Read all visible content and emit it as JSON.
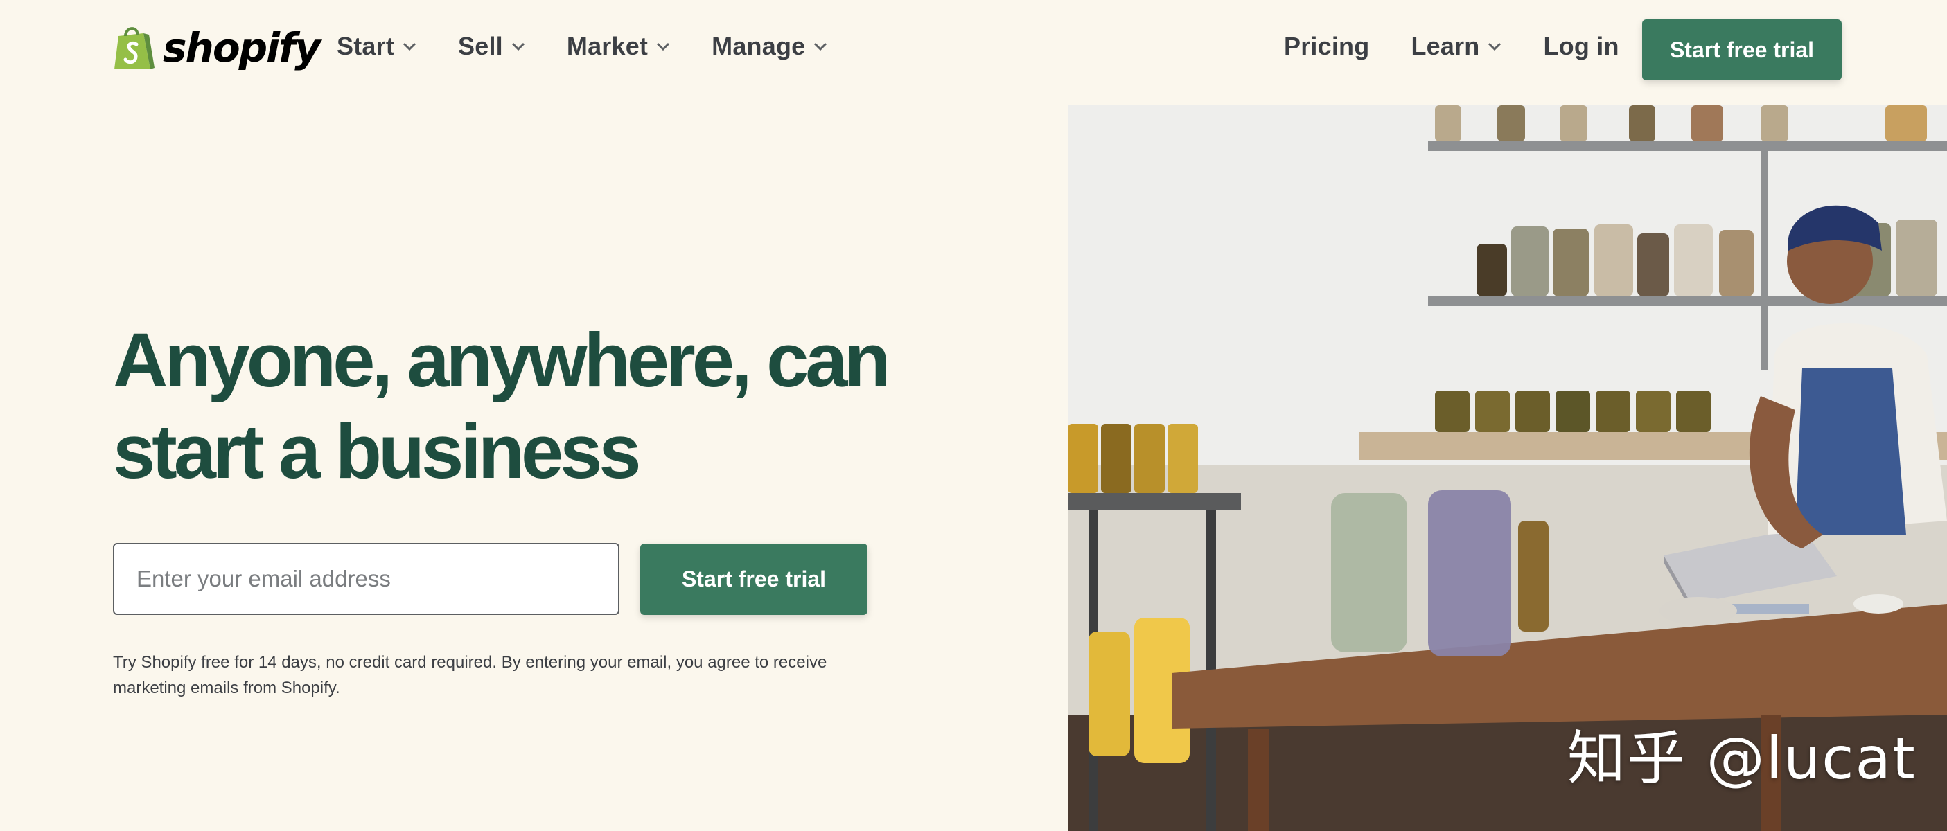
{
  "brand": {
    "name": "shopify",
    "logo_icon": "shopping-bag-icon",
    "logo_color": "#95bf47"
  },
  "nav": {
    "left": [
      {
        "label": "Start",
        "icon": "chevron-down-icon"
      },
      {
        "label": "Sell",
        "icon": "chevron-down-icon"
      },
      {
        "label": "Market",
        "icon": "chevron-down-icon"
      },
      {
        "label": "Manage",
        "icon": "chevron-down-icon"
      }
    ],
    "right": {
      "pricing": "Pricing",
      "learn": "Learn",
      "login": "Log in"
    },
    "cta": "Start free trial"
  },
  "hero": {
    "title_line1": "Anyone, anywhere, can",
    "title_line2": "start a business",
    "email_placeholder": "Enter your email address",
    "cta": "Start free trial",
    "disclaimer": "Try Shopify free for 14 days, no credit card required. By entering your email, you agree to receive marketing emails from Shopify."
  },
  "photo": {
    "watermark": "知乎 @lucat"
  },
  "colors": {
    "accent": "#3a7a5f",
    "heading": "#1e4d3f",
    "background": "#fbf7ed"
  }
}
